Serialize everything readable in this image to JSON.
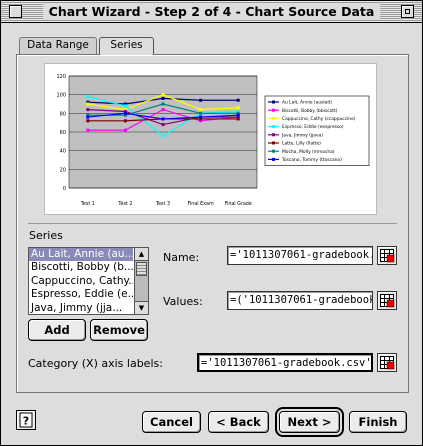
{
  "window": {
    "title": "Chart Wizard - Step 2 of 4 - Chart Source Data"
  },
  "tabs": [
    {
      "label": "Data Range",
      "active": false
    },
    {
      "label": "Series",
      "active": true
    }
  ],
  "chart_data": {
    "type": "line",
    "categories": [
      "Test 1",
      "Test 2",
      "Test 3",
      "Final Exam",
      "Final Grade"
    ],
    "ylim": [
      0,
      120
    ],
    "yticks": [
      0,
      20,
      40,
      60,
      80,
      100,
      120
    ],
    "plot_background": "#c0c0c0",
    "grid": true,
    "legend_position": "right",
    "series": [
      {
        "name": "Au Lait, Annie (auslait)",
        "color": "#000080",
        "values": [
          92,
          90,
          96,
          94,
          94
        ]
      },
      {
        "name": "Biscotti, Bobby (bbiscott)",
        "color": "#ff00ff",
        "values": [
          62,
          62,
          84,
          72,
          76
        ]
      },
      {
        "name": "Cappuccino, Cathy (ccappuccino)",
        "color": "#ffff00",
        "values": [
          90,
          84,
          100,
          84,
          86
        ]
      },
      {
        "name": "Espresso, Eddie (eespresso)",
        "color": "#00ffff",
        "values": [
          98,
          88,
          56,
          80,
          82
        ]
      },
      {
        "name": "Java, Jimmy (jjava)",
        "color": "#800080",
        "values": [
          84,
          82,
          68,
          76,
          76
        ]
      },
      {
        "name": "Latte, Lilly (llatte)",
        "color": "#800000",
        "values": [
          72,
          72,
          74,
          74,
          74
        ]
      },
      {
        "name": "Mocha, Molly (mmocha)",
        "color": "#008080",
        "values": [
          78,
          78,
          90,
          80,
          80
        ]
      },
      {
        "name": "Toscano, Tommy (ttoscano)",
        "color": "#0000ff",
        "values": [
          76,
          80,
          74,
          76,
          78
        ]
      }
    ]
  },
  "series_section": {
    "label": "Series",
    "items": [
      "Au Lait, Annie (au...",
      "Biscotti, Bobby (b...",
      "Cappuccino, Cathy...",
      "Espresso, Eddie (e...",
      "Java, Jimmy (jja..."
    ],
    "selected_index": 0,
    "add_label": "Add",
    "remove_label": "Remove"
  },
  "name_field": {
    "label": "Name:",
    "value": "='1011307061-gradebook.c"
  },
  "values_field": {
    "label": "Values:",
    "value": "=('1011307061-gradebook"
  },
  "category_field": {
    "label": "Category (X) axis labels:",
    "value": "='1011307061-gradebook.csv'!$I"
  },
  "footer": {
    "cancel": "Cancel",
    "back": "< Back",
    "next": "Next >",
    "finish": "Finish"
  }
}
